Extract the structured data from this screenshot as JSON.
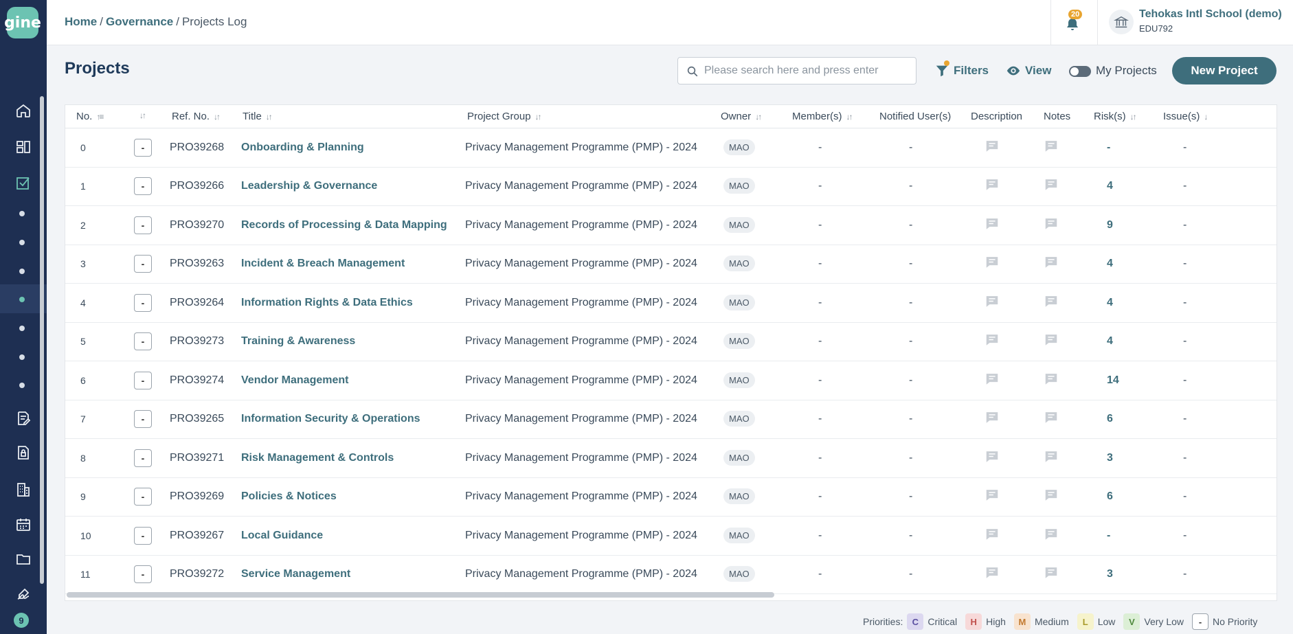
{
  "sidebar": {
    "logo_text": "gine",
    "bottom_badge": "9",
    "icons": [
      "home-icon",
      "dashboard-icon",
      "checkbox-icon",
      "edit-document-icon",
      "lock-icon",
      "building-icon",
      "calendar-icon",
      "folder-icon",
      "signature-icon"
    ]
  },
  "breadcrumb": {
    "home": "Home",
    "governance": "Governance",
    "current": "Projects Log"
  },
  "notifications": {
    "count": "20"
  },
  "org": {
    "name": "Tehokas Intl School (demo)",
    "code": "EDU792"
  },
  "page": {
    "title": "Projects"
  },
  "search": {
    "placeholder": "Please search here and press enter"
  },
  "toolbar": {
    "filters_label": "Filters",
    "view_label": "View",
    "my_projects_label": "My Projects",
    "new_project_label": "New Project"
  },
  "table": {
    "headers": {
      "no": "No.",
      "ref": "Ref. No.",
      "title": "Title",
      "group": "Project Group",
      "owner": "Owner",
      "members": "Member(s)",
      "notified": "Notified User(s)",
      "description": "Description",
      "notes": "Notes",
      "risks": "Risk(s)",
      "issues": "Issue(s)"
    },
    "rows": [
      {
        "no": "0",
        "priority": "-",
        "ref": "PRO39268",
        "title": "Onboarding & Planning",
        "group": "Privacy Management Programme (PMP) - 2024",
        "owner": "MAO",
        "members": "-",
        "notified": "-",
        "risks": "-",
        "issues": "-"
      },
      {
        "no": "1",
        "priority": "-",
        "ref": "PRO39266",
        "title": "Leadership & Governance",
        "group": "Privacy Management Programme (PMP) - 2024",
        "owner": "MAO",
        "members": "-",
        "notified": "-",
        "risks": "4",
        "issues": "-"
      },
      {
        "no": "2",
        "priority": "-",
        "ref": "PRO39270",
        "title": "Records of Processing & Data Mapping",
        "group": "Privacy Management Programme (PMP) - 2024",
        "owner": "MAO",
        "members": "-",
        "notified": "-",
        "risks": "9",
        "issues": "-"
      },
      {
        "no": "3",
        "priority": "-",
        "ref": "PRO39263",
        "title": "Incident & Breach Management",
        "group": "Privacy Management Programme (PMP) - 2024",
        "owner": "MAO",
        "members": "-",
        "notified": "-",
        "risks": "4",
        "issues": "-"
      },
      {
        "no": "4",
        "priority": "-",
        "ref": "PRO39264",
        "title": "Information Rights & Data Ethics",
        "group": "Privacy Management Programme (PMP) - 2024",
        "owner": "MAO",
        "members": "-",
        "notified": "-",
        "risks": "4",
        "issues": "-"
      },
      {
        "no": "5",
        "priority": "-",
        "ref": "PRO39273",
        "title": "Training & Awareness",
        "group": "Privacy Management Programme (PMP) - 2024",
        "owner": "MAO",
        "members": "-",
        "notified": "-",
        "risks": "4",
        "issues": "-"
      },
      {
        "no": "6",
        "priority": "-",
        "ref": "PRO39274",
        "title": "Vendor Management",
        "group": "Privacy Management Programme (PMP) - 2024",
        "owner": "MAO",
        "members": "-",
        "notified": "-",
        "risks": "14",
        "issues": "-"
      },
      {
        "no": "7",
        "priority": "-",
        "ref": "PRO39265",
        "title": "Information Security & Operations",
        "group": "Privacy Management Programme (PMP) - 2024",
        "owner": "MAO",
        "members": "-",
        "notified": "-",
        "risks": "6",
        "issues": "-"
      },
      {
        "no": "8",
        "priority": "-",
        "ref": "PRO39271",
        "title": "Risk Management & Controls",
        "group": "Privacy Management Programme (PMP) - 2024",
        "owner": "MAO",
        "members": "-",
        "notified": "-",
        "risks": "3",
        "issues": "-"
      },
      {
        "no": "9",
        "priority": "-",
        "ref": "PRO39269",
        "title": "Policies & Notices",
        "group": "Privacy Management Programme (PMP) - 2024",
        "owner": "MAO",
        "members": "-",
        "notified": "-",
        "risks": "6",
        "issues": "-"
      },
      {
        "no": "10",
        "priority": "-",
        "ref": "PRO39267",
        "title": "Local Guidance",
        "group": "Privacy Management Programme (PMP) - 2024",
        "owner": "MAO",
        "members": "-",
        "notified": "-",
        "risks": "-",
        "issues": "-"
      },
      {
        "no": "11",
        "priority": "-",
        "ref": "PRO39272",
        "title": "Service Management",
        "group": "Privacy Management Programme (PMP) - 2024",
        "owner": "MAO",
        "members": "-",
        "notified": "-",
        "risks": "3",
        "issues": "-"
      }
    ]
  },
  "legend": {
    "label": "Priorities:",
    "items": [
      {
        "code": "C",
        "label": "Critical",
        "bg": "#dcd8f0",
        "fg": "#5a4fa0"
      },
      {
        "code": "H",
        "label": "High",
        "bg": "#f7d9d9",
        "fg": "#c0504d"
      },
      {
        "code": "M",
        "label": "Medium",
        "bg": "#f8e3cf",
        "fg": "#c27a30"
      },
      {
        "code": "L",
        "label": "Low",
        "bg": "#f6f3cc",
        "fg": "#a89a2a"
      },
      {
        "code": "V",
        "label": "Very Low",
        "bg": "#dcefd6",
        "fg": "#4f8a3e"
      },
      {
        "code": "-",
        "label": "No Priority",
        "bg": "#ffffff",
        "fg": "#333333"
      }
    ]
  },
  "colors": {
    "sidebar": "#1e2f52",
    "accent": "#3e6e7c",
    "logo": "#6cc3b2",
    "badge": "#e8a531"
  }
}
